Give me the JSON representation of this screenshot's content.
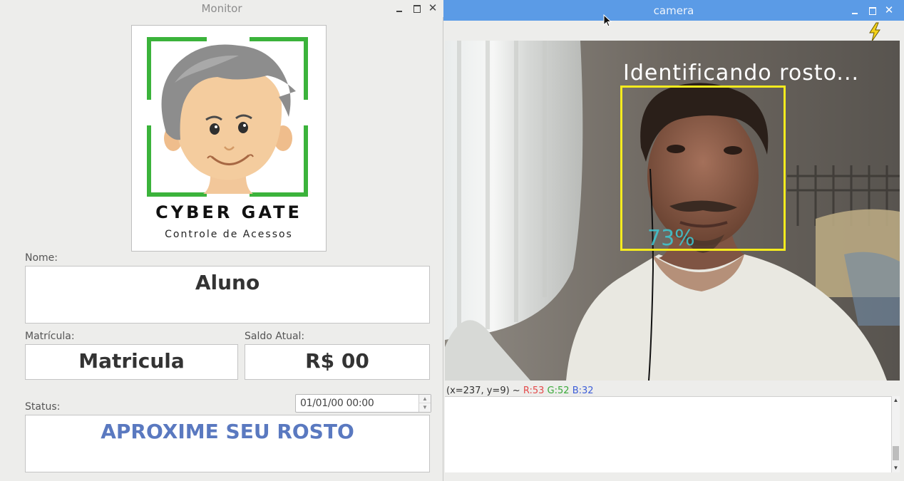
{
  "monitor": {
    "title": "Monitor",
    "logo": {
      "name": "CYBER GATE",
      "tagline": "Controle de Acessos"
    },
    "nome": {
      "label": "Nome:",
      "value": "Aluno"
    },
    "matricula": {
      "label": "Matrícula:",
      "value": "Matricula"
    },
    "saldo": {
      "label": "Saldo Atual:",
      "value": "R$ 00"
    },
    "status": {
      "label": "Status:",
      "value": "APROXIME SEU ROSTO"
    },
    "datetime": "01/01/00 00:00",
    "controls": {
      "minimize": "minimize-icon",
      "maximize": "maximize-icon",
      "close": "close-icon"
    }
  },
  "camera": {
    "title": "camera",
    "toolbar": {
      "flash_icon": "lightning-icon"
    },
    "overlay": {
      "caption": "Identificando rosto...",
      "confidence": "73%"
    },
    "status": {
      "coords": "(x=237, y=9) ~",
      "r": "R:53",
      "g": "G:52",
      "b": "B:32"
    }
  },
  "colors": {
    "camera_titlebar": "#5b9be6",
    "face_box": "#f5eb1e",
    "status_text": "#5a79c0",
    "logo_frame_green": "#3bb33b",
    "confidence_text": "#3ec9d4"
  }
}
